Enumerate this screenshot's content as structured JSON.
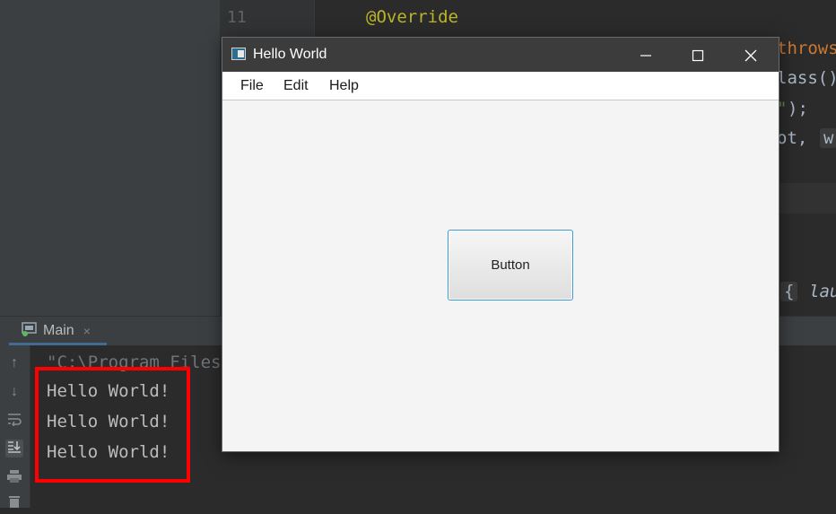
{
  "editor": {
    "line_number": "11",
    "line_annotation": "@Override",
    "fragment_throws": "throws",
    "fragment_class": "lass()",
    "fragment_quote": "\"",
    "fragment_paren": ");",
    "fragment_ot": "ot,",
    "fragment_hint": "w",
    "fragment_brace": "{",
    "fragment_lau": "lau"
  },
  "run_panel": {
    "tab_label": "Main",
    "close_glyph": "×",
    "command_line": "\"C:\\Program Files",
    "output_lines": [
      "Hello World!",
      "Hello World!",
      "Hello World!"
    ]
  },
  "app_window": {
    "title": "Hello World",
    "minimize_glyph": "—",
    "maximize_glyph": "☐",
    "close_glyph": "✕",
    "menu": [
      "File",
      "Edit",
      "Help"
    ],
    "button_label": "Button"
  }
}
